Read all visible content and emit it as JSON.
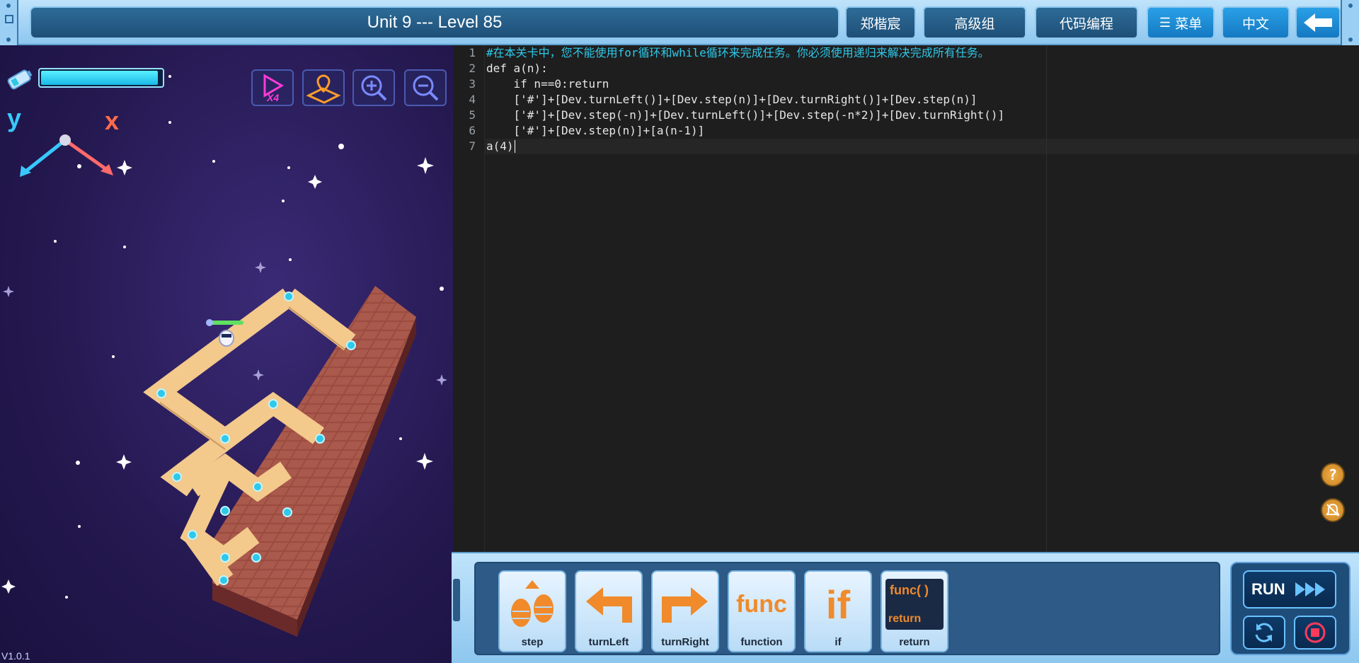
{
  "header": {
    "title": "Unit 9 --- Level 85",
    "user_name": "郑楷宸",
    "group": "高级组",
    "mode": "代码编程",
    "menu_label": "菜单",
    "language": "中文"
  },
  "game": {
    "energy_fraction": 0.97,
    "axis_y": "y",
    "axis_x": "x",
    "buttons": [
      "speed-x4",
      "map",
      "zoom-in",
      "zoom-out"
    ],
    "speed_label": "X4",
    "version": "V1.0.1"
  },
  "editor": {
    "line_numbers": [
      "1",
      "2",
      "3",
      "4",
      "5",
      "6",
      "7"
    ],
    "lines": [
      "#在本关卡中，您不能使用for循环和while循环来完成任务。你必须使用递归来解决完成所有任务。",
      "def a(n):",
      "    if n==0:return",
      "    ['#']+[Dev.turnLeft()]+[Dev.step(n)]+[Dev.turnRight()]+[Dev.step(n)]",
      "    ['#']+[Dev.step(-n)]+[Dev.turnLeft()]+[Dev.step(-n*2)]+[Dev.turnRight()]",
      "    ['#']+[Dev.step(n)]+[a(n-1)]",
      "a(4)"
    ],
    "help_icon": "question-icon",
    "mute_icon": "bell-slash-icon"
  },
  "blocks": {
    "items": [
      {
        "label": "step",
        "icon": "footsteps"
      },
      {
        "label": "turnLeft",
        "icon": "turn-left-arrow"
      },
      {
        "label": "turnRight",
        "icon": "turn-right-arrow"
      },
      {
        "label": "function",
        "icon": "func"
      },
      {
        "label": "if",
        "icon": "if"
      },
      {
        "label": "return",
        "icon": "func-return"
      }
    ],
    "func_text": "func",
    "if_text": "if",
    "return_func_text": "func( )",
    "return_text": "return"
  },
  "controls": {
    "run_label": "RUN",
    "reset_icon": "refresh-icon",
    "stop_icon": "stop-icon"
  },
  "colors": {
    "accent": "#2aa0e6",
    "path_tile": "#f3c98c",
    "goal_tile": "#8b3a3a",
    "comment": "#2ec8e8"
  }
}
